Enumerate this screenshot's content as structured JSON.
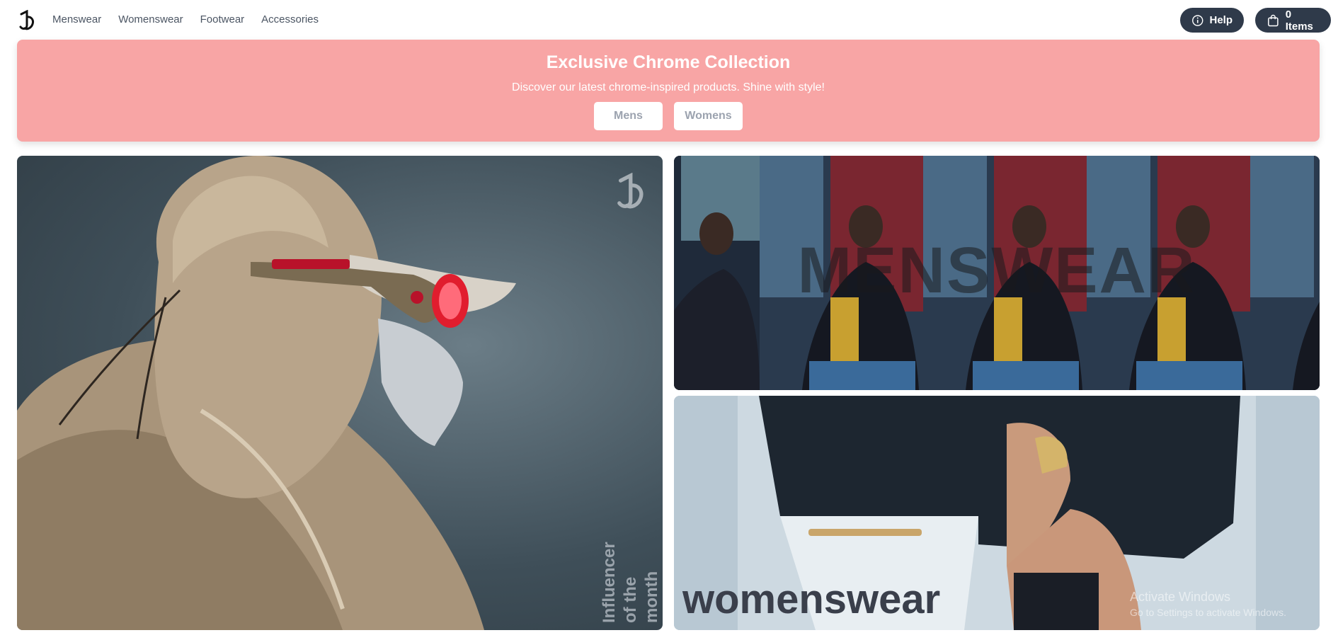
{
  "nav": {
    "items": [
      "Menswear",
      "Womenswear",
      "Footwear",
      "Accessories"
    ]
  },
  "header": {
    "help_label": "Help",
    "cart_label": "0 Items"
  },
  "banner": {
    "title": "Exclusive Chrome Collection",
    "subtitle": "Discover our latest chrome-inspired products. Shine with style!",
    "buttons": [
      "Mens",
      "Womens"
    ]
  },
  "hero": {
    "caption_lines": [
      "Influencer",
      "of the",
      "month"
    ]
  },
  "tiles": {
    "mens_title": "MENSWEAR",
    "womens_title": "womenswear"
  },
  "watermark": {
    "line1": "Activate Windows",
    "line2": "Go to Settings to activate Windows."
  },
  "colors": {
    "banner_bg": "#f8a5a5",
    "pill_bg": "#2f3a4a",
    "accent_red": "#e11d2e"
  }
}
